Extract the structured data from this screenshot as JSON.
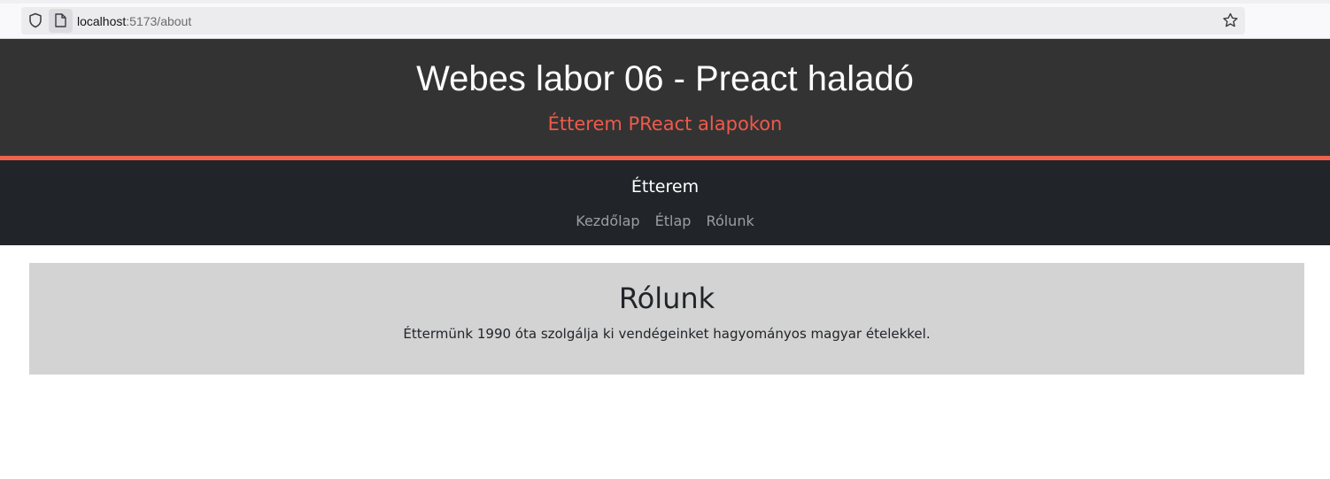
{
  "browser": {
    "url_host": "localhost",
    "url_rest": ":5173/about",
    "icons": [
      "shield-icon",
      "page-icon",
      "bookmark-star-icon"
    ]
  },
  "header": {
    "title": "Webes labor 06 - Preact haladó",
    "subtitle": "Étterem PReact alapokon"
  },
  "nav": {
    "brand": "Étterem",
    "links": [
      {
        "label": "Kezdőlap"
      },
      {
        "label": "Étlap"
      },
      {
        "label": "Rólunk"
      }
    ]
  },
  "about": {
    "heading": "Rólunk",
    "text": "Éttermünk 1990 óta szolgálja ki vendégeinket hagyományos magyar ételekkel."
  },
  "colors": {
    "header_bg": "#333333",
    "accent": "#f0624d",
    "navbar_bg": "#212529",
    "panel_bg": "#d3d3d3"
  }
}
